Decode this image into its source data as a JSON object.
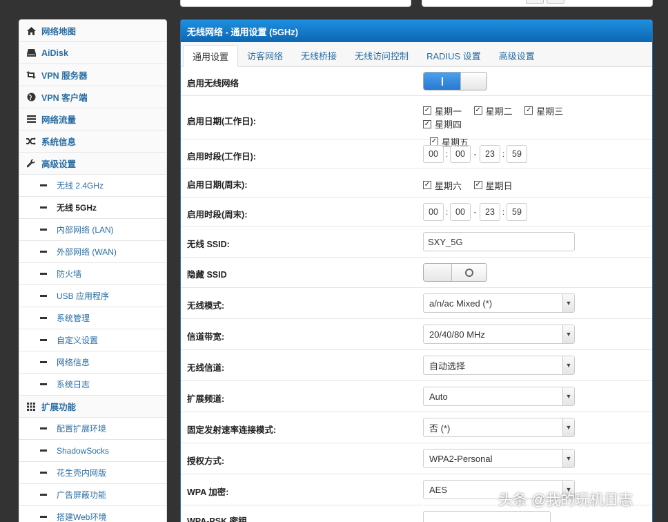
{
  "sidebar": {
    "items": [
      {
        "label": "网络地图",
        "icon": "home-icon"
      },
      {
        "label": "AiDisk",
        "icon": "disk-icon"
      },
      {
        "label": "VPN 服务器",
        "icon": "retweet-icon"
      },
      {
        "label": "VPN 客户端",
        "icon": "globe-icon"
      },
      {
        "label": "网络流量",
        "icon": "list-icon"
      },
      {
        "label": "系统信息",
        "icon": "shuffle-icon"
      },
      {
        "label": "高级设置",
        "icon": "wrench-icon"
      }
    ],
    "sub_items": [
      "无线 2.4GHz",
      "无线 5GHz",
      "内部网络 (LAN)",
      "外部网络 (WAN)",
      "防火墙",
      "USB 应用程序",
      "系统管理",
      "自定义设置",
      "网络信息",
      "系统日志"
    ],
    "ext_section": {
      "label": "扩展功能",
      "icon": "grid-icon"
    },
    "ext_items": [
      "配置扩展环境",
      "ShadowSocks",
      "花生壳内网版",
      "广告屏蔽功能",
      "搭建Web环境"
    ]
  },
  "panel": {
    "title": "无线网络 - 通用设置 (5GHz)",
    "tabs": [
      "通用设置",
      "访客网络",
      "无线桥接",
      "无线访问控制",
      "RADIUS 设置",
      "高级设置"
    ]
  },
  "form": {
    "enable_wireless": {
      "label": "启用无线网络",
      "value": true
    },
    "weekday_dates": {
      "label": "启用日期(工作日):",
      "days": [
        "星期一",
        "星期二",
        "星期三",
        "星期四",
        "星期五"
      ]
    },
    "weekday_time": {
      "label": "启用时段(工作日):",
      "start_h": "00",
      "start_m": "00",
      "end_h": "23",
      "end_m": "59"
    },
    "weekend_dates": {
      "label": "启用日期(周末):",
      "days": [
        "星期六",
        "星期日"
      ]
    },
    "weekend_time": {
      "label": "启用时段(周末):",
      "start_h": "00",
      "start_m": "00",
      "end_h": "23",
      "end_m": "59"
    },
    "ssid": {
      "label": "无线 SSID:",
      "value": "SXY_5G"
    },
    "hide_ssid": {
      "label": "隐藏 SSID",
      "value": false
    },
    "mode": {
      "label": "无线模式:",
      "value": "a/n/ac Mixed (*)"
    },
    "bandwidth": {
      "label": "信道带宽:",
      "value": "20/40/80 MHz"
    },
    "channel": {
      "label": "无线信道:",
      "value": "自动选择"
    },
    "ext_channel": {
      "label": "扩展频道:",
      "value": "Auto"
    },
    "fixed_rate": {
      "label": "固定发射速率连接模式:",
      "value": "否 (*)"
    },
    "auth": {
      "label": "授权方式:",
      "value": "WPA2-Personal"
    },
    "wpa_enc": {
      "label": "WPA 加密:",
      "value": "AES"
    },
    "wpa_psk": {
      "label": "WPA-PSK 密钥"
    }
  },
  "watermark": "头条 @我的玩机日志"
}
